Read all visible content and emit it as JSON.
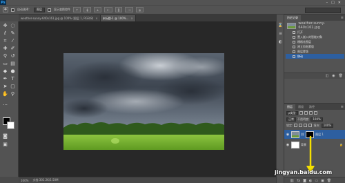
{
  "app": {
    "logo": "Ps",
    "menu": [
      "",
      "",
      "",
      "",
      "",
      "",
      "",
      "",
      "",
      "",
      ""
    ],
    "window_controls": [
      "–",
      "□",
      "✕"
    ]
  },
  "options_bar": {
    "auto_select_label": "自动选择：",
    "auto_select_value": "图层",
    "show_transform_label": "显示变换控件"
  },
  "document": {
    "tabs": [
      {
        "label": "weather-sunny-640x161.jpg @ 100% (图层 1, RGB/8)",
        "active": false
      },
      {
        "label": "未标题-1 @ 100%...",
        "active": true
      }
    ]
  },
  "status_bar": {
    "zoom": "100%",
    "doc_info": "文档:301.2K/1.50M"
  },
  "history": {
    "tab_label": "历史记录",
    "snapshot_label": "weather-sunny-640x161.jpg",
    "items": [
      {
        "label": "打开",
        "active": false
      },
      {
        "label": "置入嵌入的智能对象",
        "active": false
      },
      {
        "label": "栅格化图层",
        "active": false
      },
      {
        "label": "建立剪贴蒙版",
        "active": false
      },
      {
        "label": "图层蒙版",
        "active": false
      },
      {
        "label": "移动",
        "active": true
      }
    ]
  },
  "layers": {
    "tabs": [
      "图层",
      "通道",
      "路径"
    ],
    "kind_label": "ρ类型",
    "blend_mode": "正常",
    "opacity_label": "不透明度:",
    "opacity_value": "100%",
    "lock_label": "锁定:",
    "fill_label": "填充:",
    "fill_value": "100%",
    "rows": [
      {
        "name": "图层 1",
        "selected": true
      },
      {
        "name": "背景",
        "selected": false
      }
    ]
  },
  "watermark": "jingyan.baidu.com",
  "colors": {
    "accent": "#f5e000",
    "selection": "#2d5fa0"
  }
}
